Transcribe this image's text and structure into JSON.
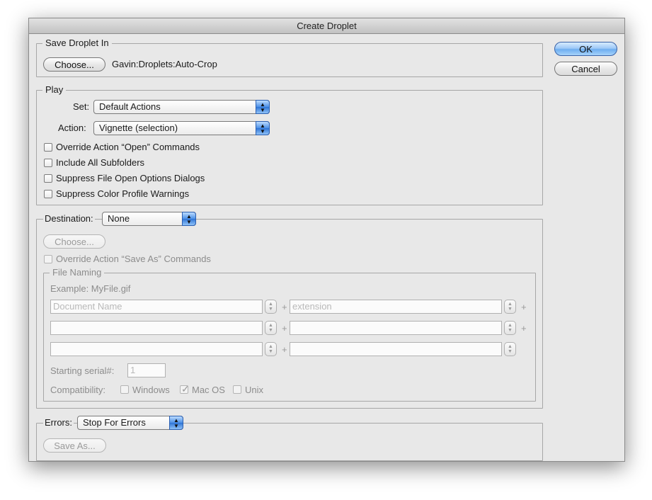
{
  "window": {
    "title": "Create Droplet"
  },
  "buttons": {
    "ok": "OK",
    "cancel": "Cancel"
  },
  "save_in": {
    "legend": "Save Droplet In",
    "choose": "Choose...",
    "path": "Gavin:Droplets:Auto-Crop"
  },
  "play": {
    "legend": "Play",
    "set_label": "Set:",
    "set_value": "Default Actions",
    "action_label": "Action:",
    "action_value": "Vignette (selection)",
    "options": [
      {
        "label": "Override Action “Open” Commands",
        "checked": false
      },
      {
        "label": "Include All Subfolders",
        "checked": false
      },
      {
        "label": "Suppress File Open Options Dialogs",
        "checked": false
      },
      {
        "label": "Suppress Color Profile Warnings",
        "checked": false
      }
    ]
  },
  "destination": {
    "label": "Destination:",
    "value": "None",
    "choose": "Choose...",
    "override_label": "Override Action “Save As” Commands",
    "file_naming": {
      "legend": "File Naming",
      "example": "Example: MyFile.gif",
      "fields": [
        {
          "left": "Document Name",
          "right": "extension"
        },
        {
          "left": "",
          "right": ""
        },
        {
          "left": "",
          "right": ""
        }
      ],
      "plus": "+",
      "serial_label": "Starting serial#:",
      "serial_value": "1",
      "compat_label": "Compatibility:",
      "compat": [
        {
          "label": "Windows",
          "checked": false
        },
        {
          "label": "Mac OS",
          "checked": true
        },
        {
          "label": "Unix",
          "checked": false
        }
      ]
    }
  },
  "errors": {
    "label": "Errors:",
    "value": "Stop For Errors",
    "save_as": "Save As..."
  }
}
